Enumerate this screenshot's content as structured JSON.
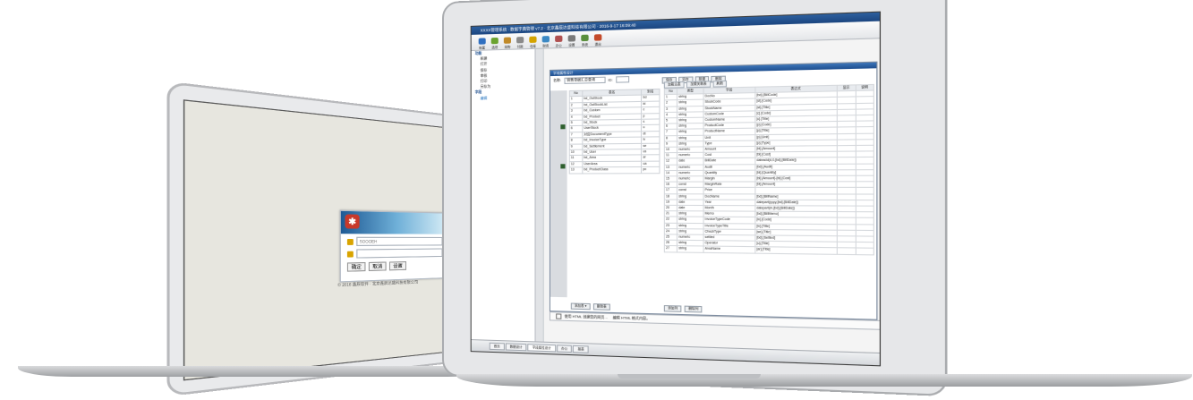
{
  "login_screen": {
    "username_value": "SOOOEH",
    "password_value": "",
    "login_button": "确定",
    "cancel_button": "取消",
    "settings_button": "设置",
    "copyright": "© 2016 鑫辰软件 · 北京鑫辰达盛科技有限公司"
  },
  "app": {
    "title": "XXXX管理系统 · 数据字典管理 v7.2 · 北京鑫辰达盛科技有限公司 · 2016-9-17 16:09:40",
    "toolbar": [
      {
        "label": "帐套",
        "color": "#2f6fc0"
      },
      {
        "label": "选项",
        "color": "#6aa32f"
      },
      {
        "label": "采购",
        "color": "#c08a2a"
      },
      {
        "label": "付款",
        "color": "#8a8a8a"
      },
      {
        "label": "仓库",
        "color": "#d4a300"
      },
      {
        "label": "财务",
        "color": "#3b88c4"
      },
      {
        "label": "办公",
        "color": "#b05050"
      },
      {
        "label": "设置",
        "color": "#7a7a7a"
      },
      {
        "label": "系统",
        "color": "#5a8f3c"
      },
      {
        "label": "退出",
        "color": "#c44a2a"
      }
    ],
    "tree": {
      "head": "功能",
      "items": [
        "新建",
        "打开",
        "保存",
        "审核",
        "打印",
        "另存为"
      ],
      "head2": "字段",
      "selected": "编辑"
    },
    "panel": {
      "title": "字段属性设计",
      "name_label": "名称:",
      "name_value": "销售单据汇总查询",
      "id_label": "ID:",
      "buttons": [
        "保存",
        "另存",
        "新建",
        "删除"
      ],
      "sub_tabs": [
        "加载主表",
        "加载关联表",
        "刷新"
      ],
      "left_cols": [
        "No",
        "表名",
        "别名"
      ],
      "left_rows": [
        [
          "1",
          "bd_OutStock",
          "bd"
        ],
        [
          "2",
          "bd_OutStockList",
          "bl"
        ],
        [
          "3",
          "bd_Custom",
          "c"
        ],
        [
          "4",
          "bd_Product",
          "p"
        ],
        [
          "5",
          "bd_Stock",
          "s"
        ],
        [
          "6",
          "UserStock",
          "u"
        ],
        [
          "7",
          "对应DocumentType",
          "dt"
        ],
        [
          "8",
          "bd_InvoiceType",
          "iv"
        ],
        [
          "9",
          "bd_Settlement",
          "se"
        ],
        [
          "10",
          "bd_User",
          "us"
        ],
        [
          "11",
          "bd_Area",
          "ar"
        ],
        [
          "12",
          "UserArea",
          "ua"
        ],
        [
          "13",
          "bd_ProductClass",
          "pc"
        ]
      ],
      "right_cols": [
        "No",
        "类型",
        "字段",
        "表达式",
        "显示",
        "说明"
      ],
      "right_rows": [
        [
          "1",
          "string",
          "DocNo",
          "[bd].[BillCode]"
        ],
        [
          "2",
          "string",
          "StockCode",
          "[st].[Code]"
        ],
        [
          "3",
          "string",
          "StockName",
          "[st].[Title]"
        ],
        [
          "4",
          "string",
          "CustomCode",
          "[c].[Code]"
        ],
        [
          "5",
          "string",
          "CustomName",
          "[c].[Title]"
        ],
        [
          "6",
          "string",
          "ProductCode",
          "[p].[Code]"
        ],
        [
          "7",
          "string",
          "ProductName",
          "[p].[Title]"
        ],
        [
          "8",
          "string",
          "Unit",
          "[p].[Unit]"
        ],
        [
          "9",
          "string",
          "Type",
          "[p].[Type]"
        ],
        [
          "10",
          "numeric",
          "Amount",
          "[bl].[Amount]"
        ],
        [
          "11",
          "numeric",
          "Cost",
          "[bl].[Cost]"
        ],
        [
          "12",
          "date",
          "BillDate",
          "dateadd(d,0,[bd].[BillDate])"
        ],
        [
          "13",
          "numeric",
          "Audit",
          "[bd].[Audit]"
        ],
        [
          "14",
          "numeric",
          "Quantity",
          "[bl].[Quantity]"
        ],
        [
          "15",
          "numeric",
          "Margin",
          "[bl].[Amount]-[bl].[Cost]"
        ],
        [
          "16",
          "const",
          "MarginRate",
          "[bl].[Amount]"
        ],
        [
          "17",
          "const",
          "Price",
          ""
        ],
        [
          "18",
          "string",
          "DocName",
          "[bd].[BillName]"
        ],
        [
          "19",
          "date",
          "Year",
          "datepart(yyyy,[bd].[BillDate])"
        ],
        [
          "20",
          "date",
          "Month",
          "datepart(m,[bd].[BillDate])"
        ],
        [
          "21",
          "string",
          "Memo",
          "[bd].[BillMemo]"
        ],
        [
          "22",
          "string",
          "InvoiceTypeCode",
          "[iv].[Code]"
        ],
        [
          "23",
          "string",
          "InvoiceTypeTitle",
          "[iv].[Title]"
        ],
        [
          "24",
          "string",
          "CheckType",
          "[se].[Title]"
        ],
        [
          "25",
          "numeric",
          "settled",
          "[bd].[Settled]"
        ],
        [
          "26",
          "string",
          "Operator",
          "[u].[Title]"
        ],
        [
          "27",
          "string",
          "AreaName",
          "[ar].[Title]"
        ]
      ],
      "add_table_button": "添加表 ▾",
      "delete_table_button": "删除表",
      "add_field_button": "添加列",
      "delete_field_button": "删除列"
    },
    "command": {
      "check_label": "使用 HTML 创建您的网页…",
      "hint": "编辑 HTML 格式内容。"
    },
    "status_tabs": [
      "首页",
      "数据设计",
      "字段属性设计",
      "办公",
      "报表"
    ]
  }
}
